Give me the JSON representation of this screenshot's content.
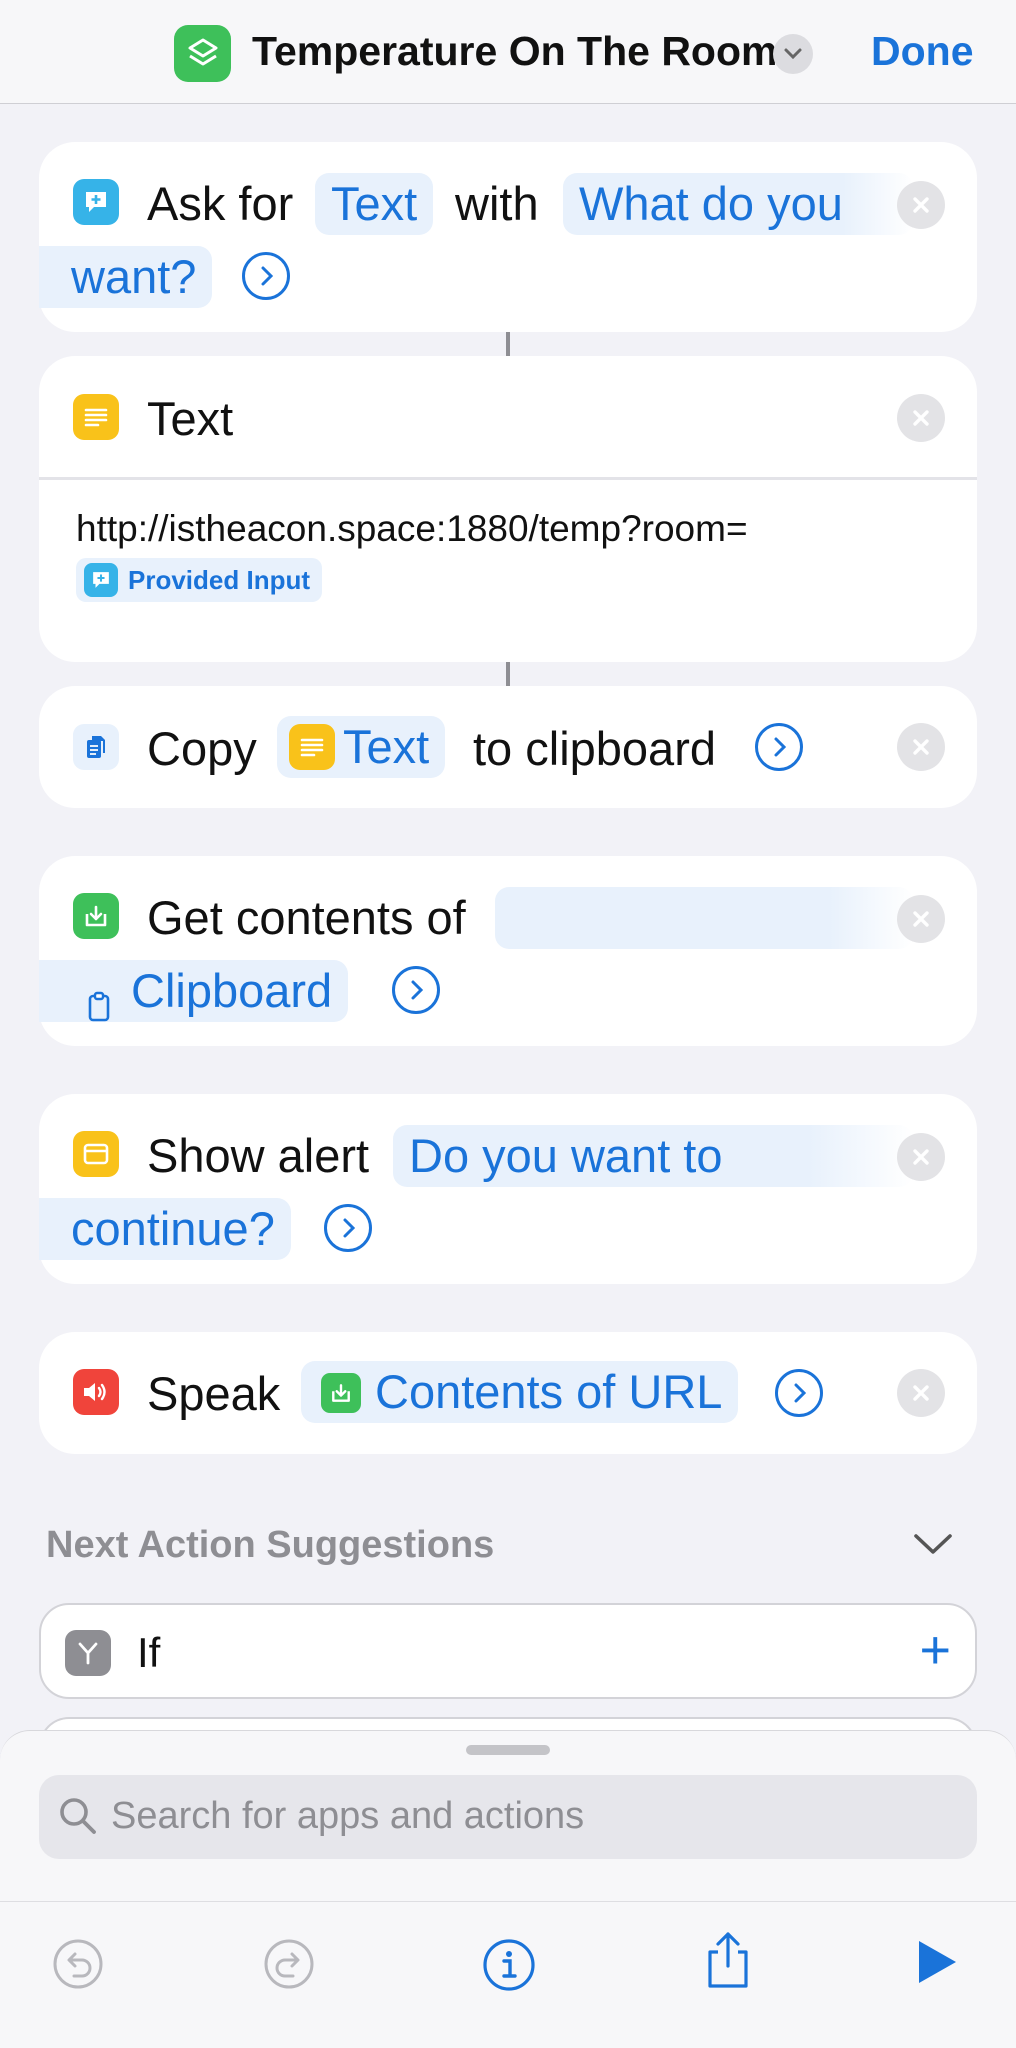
{
  "header": {
    "title": "Temperature On The Room",
    "done_label": "Done"
  },
  "actions": {
    "ask": {
      "verb": "Ask for",
      "type_token": "Text",
      "with": "with",
      "prompt_line1": "What do you",
      "prompt_line2": "want?"
    },
    "text": {
      "title": "Text",
      "body": "http://istheacon.space:1880/temp?room=",
      "variable": "Provided Input"
    },
    "copy": {
      "verb": "Copy",
      "token": "Text",
      "suffix": "to clipboard"
    },
    "get": {
      "verb": "Get contents of",
      "token": "Clipboard"
    },
    "alert": {
      "verb": "Show alert",
      "message_line1": "Do you want to",
      "message_line2": "continue?"
    },
    "speak": {
      "verb": "Speak",
      "token": "Contents of URL"
    }
  },
  "suggestions": {
    "heading": "Next Action Suggestions",
    "items": [
      {
        "label": "If"
      }
    ]
  },
  "search": {
    "placeholder": "Search for apps and actions"
  },
  "icons": {
    "app": "shortcuts-icon",
    "ask": "chat-bubble-icon",
    "text": "text-lines-icon",
    "copy": "document-copy-icon",
    "get": "download-tray-icon",
    "alert": "window-alert-icon",
    "speak": "speaker-icon",
    "if": "branch-icon"
  },
  "colors": {
    "accent": "#1a73d9",
    "background": "#f2f2f7",
    "ask_icon": "#36b3e8",
    "text_icon": "#f9c21a",
    "get_icon": "#3ec05a",
    "speak_icon": "#f0443b"
  }
}
